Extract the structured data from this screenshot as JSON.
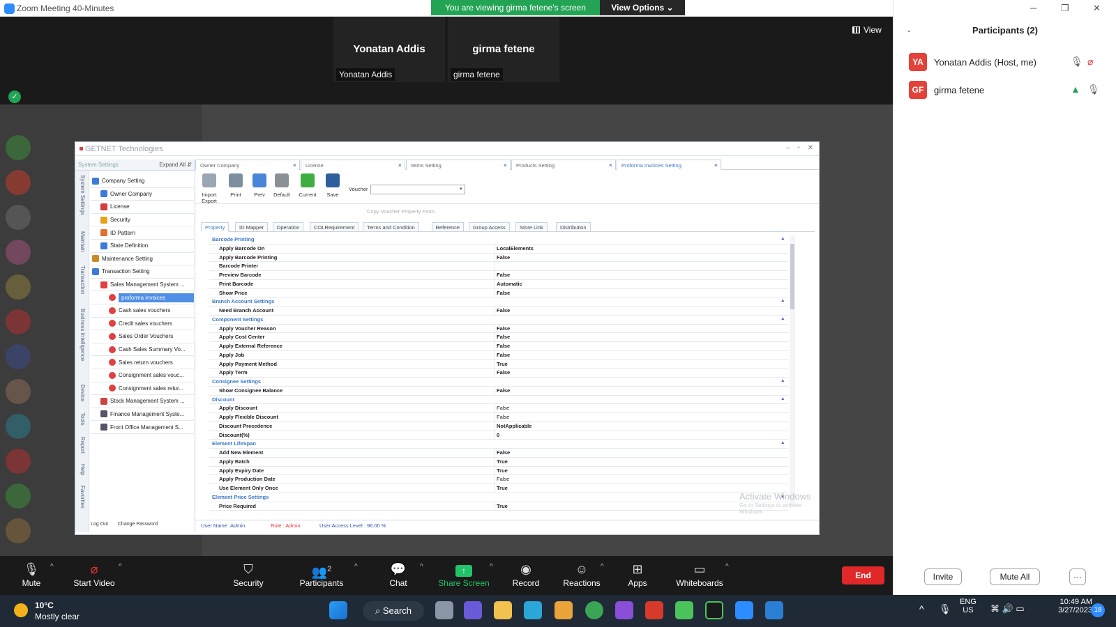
{
  "window": {
    "title": "Zoom Meeting 40-Minutes"
  },
  "banner": {
    "viewing": "You are viewing girma fetene's screen",
    "view_options": "View Options"
  },
  "top_view": {
    "label": "View"
  },
  "thumbnails": [
    {
      "name": "Yonatan Addis",
      "label": "Yonatan Addis"
    },
    {
      "name": "girma fetene",
      "label": "girma fetene"
    }
  ],
  "shared_app": {
    "title": "GETNET Technologies",
    "left_header": "System Settings",
    "expand_all": "Expand All",
    "vertical_tabs": [
      "System Settings",
      "Maintain",
      "Transaction",
      "Business Intelligence",
      "Device",
      "Tools",
      "Report",
      "Help",
      "Favorites"
    ],
    "tree": [
      {
        "label": "Company Setting",
        "level": 0,
        "color": "#3d7bd6"
      },
      {
        "label": "Owner Company",
        "level": 1,
        "color": "#3d7bd6"
      },
      {
        "label": "License",
        "level": 1,
        "color": "#d63a3a"
      },
      {
        "label": "Security",
        "level": 1,
        "color": "#e6a21a"
      },
      {
        "label": "ID Pattern",
        "level": 1,
        "color": "#e07030"
      },
      {
        "label": "State Definition",
        "level": 1,
        "color": "#3d7bd6"
      },
      {
        "label": "Maintenance Setting",
        "level": 0,
        "color": "#c98b2a"
      },
      {
        "label": "Transaction Setting",
        "level": 0,
        "color": "#3d7bd6"
      },
      {
        "label": "Sales Management System ...",
        "level": 1,
        "color": "#e04040"
      },
      {
        "label": "proforma invoices",
        "level": 2,
        "color": "#e04040",
        "selected": true
      },
      {
        "label": "Cash sales vouchers",
        "level": 2,
        "color": "#e04040"
      },
      {
        "label": "Credit sales vouchers",
        "level": 2,
        "color": "#e04040"
      },
      {
        "label": "Sales Order Vouchers",
        "level": 2,
        "color": "#e04040"
      },
      {
        "label": "Cash Sales Summary Vo...",
        "level": 2,
        "color": "#e04040"
      },
      {
        "label": "Sales return vouchers",
        "level": 2,
        "color": "#e04040"
      },
      {
        "label": "Consignment sales vouc...",
        "level": 2,
        "color": "#e04040"
      },
      {
        "label": "Consignment sales retur...",
        "level": 2,
        "color": "#e04040"
      },
      {
        "label": "Stock Management System ...",
        "level": 1,
        "color": "#c44"
      },
      {
        "label": "Finance Management Syste...",
        "level": 1,
        "color": "#556"
      },
      {
        "label": "Front Office Management S...",
        "level": 1,
        "color": "#556"
      }
    ],
    "log_out": "Log Out",
    "change_password": "Change Password",
    "doc_tabs": [
      "Owner Company",
      "License",
      "Items Setting",
      "Products Setting",
      "Proforma Invoices Setting"
    ],
    "toolbar": [
      {
        "label": "Import Export",
        "color": "#9aa6b4"
      },
      {
        "label": "Print",
        "color": "#7d8ea3"
      },
      {
        "label": "Prev",
        "color": "#4a86d8"
      },
      {
        "label": "Default",
        "color": "#8b8f96"
      },
      {
        "label": "Current",
        "color": "#3fae3f"
      },
      {
        "label": "Save",
        "color": "#2f5e9e"
      }
    ],
    "voucher_label": "Voucher",
    "copy_voucher": "Copy Voucher Property From",
    "prop_tabs": [
      "Property",
      "ID Mapper",
      "Operation",
      "COLRequirement",
      "Terms and Condition",
      "Reference",
      "Group Access",
      "Store Link",
      "Distribution"
    ],
    "grid": [
      {
        "cat": "Barcode Printing"
      },
      {
        "k": "Apply Barcode On",
        "v": "LocalElements"
      },
      {
        "k": "Apply Barcode Printing",
        "v": "False"
      },
      {
        "k": "Barcode Printer",
        "v": ""
      },
      {
        "k": "Preview Barcode",
        "v": "False"
      },
      {
        "k": "Print Barcode",
        "v": "Automatic"
      },
      {
        "k": "Show Price",
        "v": "False"
      },
      {
        "cat": "Branch Account Settings"
      },
      {
        "k": "Need Branch Account",
        "v": "False"
      },
      {
        "cat": "Component Settings"
      },
      {
        "k": "Apply Voucher Reason",
        "v": "False"
      },
      {
        "k": "Apply Cost Center",
        "v": "False"
      },
      {
        "k": "Apply External Reference",
        "v": "False"
      },
      {
        "k": "Apply Job",
        "v": "False"
      },
      {
        "k": "Apply Payment Method",
        "v": "True"
      },
      {
        "k": "Apply Term",
        "v": "False"
      },
      {
        "cat": "Consignee Settings"
      },
      {
        "k": "Show Consignee Balance",
        "v": "False"
      },
      {
        "cat": "Discount"
      },
      {
        "k": "Apply Discount",
        "v": "False",
        "light": true
      },
      {
        "k": "Apply Flexible Discount",
        "v": "False",
        "light": true
      },
      {
        "k": "Discount Precedence",
        "v": "NotApplicable"
      },
      {
        "k": "Discount(%)",
        "v": "0"
      },
      {
        "cat": "Element LifeSpan"
      },
      {
        "k": "Add New Element",
        "v": "False"
      },
      {
        "k": "Apply Batch",
        "v": "True"
      },
      {
        "k": "Apply Expiry Date",
        "v": "True"
      },
      {
        "k": "Apply Production Date",
        "v": "False",
        "light": true
      },
      {
        "k": "Use Element Only Once",
        "v": "True"
      },
      {
        "cat": "Element Price Settings"
      },
      {
        "k": "Price Required",
        "v": "True"
      }
    ],
    "activate_1": "Activate Windows",
    "activate_2": "Go to Settings to activate Windows.",
    "status": {
      "user": "User Name :Admin",
      "role": "Role : Admin",
      "access": "User Access Level   : 96.00 %"
    }
  },
  "bottom_bar": {
    "mute": "Mute",
    "start_video": "Start Video",
    "security": "Security",
    "participants": "Participants",
    "participants_count": "2",
    "chat": "Chat",
    "share": "Share Screen",
    "record": "Record",
    "reactions": "Reactions",
    "apps": "Apps",
    "whiteboards": "Whiteboards",
    "end": "End"
  },
  "participants_panel": {
    "title": "Participants (2)",
    "people": [
      {
        "initials": "YA",
        "name": "Yonatan Addis (Host, me)"
      },
      {
        "initials": "GF",
        "name": "girma fetene"
      }
    ],
    "invite": "Invite",
    "mute_all": "Mute All",
    "more": "···"
  },
  "taskbar": {
    "temp": "10°C",
    "weather": "Mostly clear",
    "search": "Search",
    "lang1": "ENG",
    "lang2": "US",
    "time": "10:49 AM",
    "date": "3/27/2023",
    "badge": "18"
  }
}
